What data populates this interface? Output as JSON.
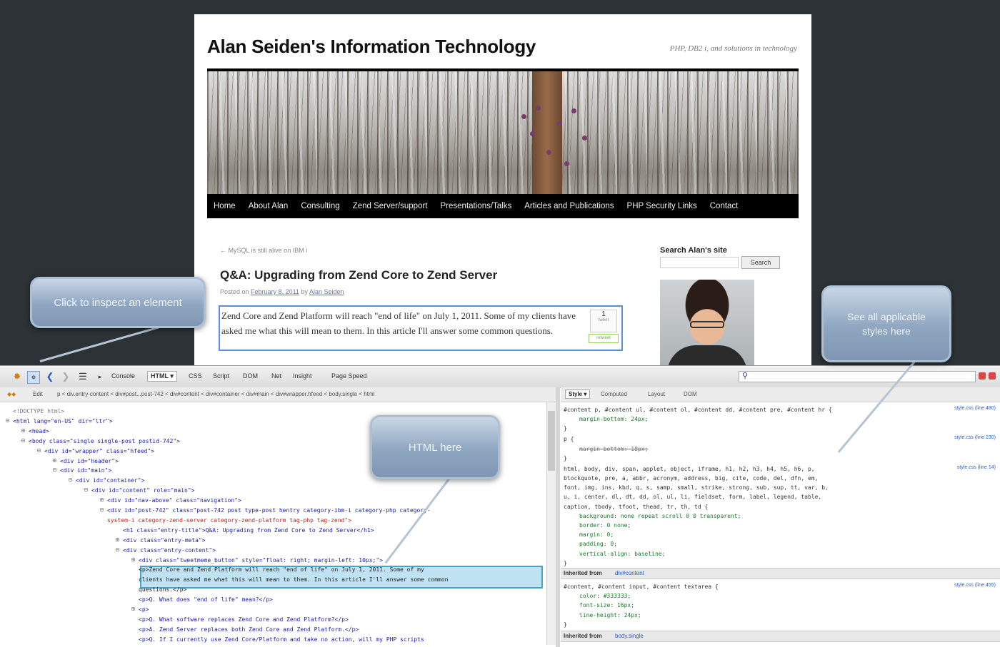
{
  "blog": {
    "title": "Alan Seiden's Information Technology",
    "description": "PHP, DB2 i, and solutions in technology",
    "nav": [
      "Home",
      "About Alan",
      "Consulting",
      "Zend Server/support",
      "Presentations/Talks",
      "Articles and Publications",
      "PHP Security Links",
      "Contact"
    ],
    "prev_link": "← MySQL is still alive on IBM i",
    "post_title": "Q&A: Upgrading from Zend Core to Zend Server",
    "meta_prefix": "Posted on",
    "meta_date": "February 8, 2011",
    "meta_by": "by",
    "meta_author": "Alan Seiden",
    "entry_text": "Zend Core and Zend Platform will reach \"end of life\" on July 1, 2011. Some of my clients have asked me what this will mean to them. In this article I'll answer some common questions.",
    "share_count": "1",
    "share_label": "tweet",
    "share_button": "retweet",
    "sidebar_search_label": "Search Alan's site",
    "sidebar_search_button": "Search"
  },
  "callouts": {
    "inspect": "Click to inspect an element",
    "html": "HTML here",
    "styles": "See all applicable styles here"
  },
  "firebug": {
    "tabs": [
      "Console",
      "HTML ▾",
      "CSS",
      "Script",
      "DOM",
      "Net",
      "Insight",
      "Page Speed"
    ],
    "active_tab": "HTML ▾",
    "edit_label": "Edit",
    "breadcrumb": "p  <  div.entry-content  <  div#post...post-742  <  div#content  <  div#container  <  div#main  <  div#wrapper.hfeed  <  body.single  <  html",
    "side_tabs": [
      "Style ▾",
      "Computed",
      "Layout",
      "DOM"
    ],
    "html_lines": [
      {
        "indent": 0,
        "text": "<!DOCTYPE html>",
        "cls": "tw"
      },
      {
        "indent": 0,
        "text": "<html lang=\"en-US\" dir=\"ltr\">",
        "cls": "tg",
        "exp": "−"
      },
      {
        "indent": 1,
        "text": "<head>",
        "cls": "tg",
        "exp": "+"
      },
      {
        "indent": 1,
        "text": "<body class=\"single single-post postid-742\">",
        "cls": "tg",
        "exp": "−"
      },
      {
        "indent": 2,
        "text": "<div id=\"wrapper\" class=\"hfeed\">",
        "cls": "tg",
        "exp": "−"
      },
      {
        "indent": 3,
        "text": "<div id=\"header\">",
        "cls": "tg",
        "exp": "+"
      },
      {
        "indent": 3,
        "text": "<div id=\"main\">",
        "cls": "tg",
        "exp": "−"
      },
      {
        "indent": 4,
        "text": "<div id=\"container\">",
        "cls": "tg",
        "exp": "−"
      },
      {
        "indent": 5,
        "text": "<div id=\"content\" role=\"main\">",
        "cls": "tg",
        "exp": "−"
      },
      {
        "indent": 6,
        "text": "<div id=\"nav-above\" class=\"navigation\">",
        "cls": "tg",
        "exp": "+"
      },
      {
        "indent": 6,
        "text": "<div id=\"post-742\" class=\"post-742 post type-post hentry category-ibm-i category-php category-",
        "cls": "tg",
        "exp": "−"
      },
      {
        "indent": 6,
        "text": "system-i category-zend-server category-zend-platform tag-php tag-zend\">",
        "cls": "st"
      },
      {
        "indent": 7,
        "text": "<h1 class=\"entry-title\">Q&A: Upgrading from Zend Core to Zend Server</h1>",
        "cls": "tg"
      },
      {
        "indent": 7,
        "text": "<div class=\"entry-meta\">",
        "cls": "tg",
        "exp": "+"
      },
      {
        "indent": 7,
        "text": "<div class=\"entry-content\">",
        "cls": "tg",
        "exp": "−"
      },
      {
        "indent": 8,
        "text": "<div class=\"tweetmeme_button\" style=\"float: right; margin-left: 10px;\">",
        "cls": "tg",
        "exp": "+"
      },
      {
        "indent": 8,
        "text": "<p>Zend Core and Zend Platform will reach \"end of life\" on July 1, 2011. Some of my",
        "cls": "tx"
      },
      {
        "indent": 8,
        "text": "clients have asked me what this will mean to them. In this article I'll answer some common",
        "cls": "tx"
      },
      {
        "indent": 8,
        "text": "questions.</p>",
        "cls": "tx"
      },
      {
        "indent": 8,
        "text": "<p>Q. What does \"end of life\" mean?</p>",
        "cls": "tg"
      },
      {
        "indent": 8,
        "text": "<p>",
        "cls": "tg",
        "exp": "+"
      },
      {
        "indent": 8,
        "text": "<p>Q. What software replaces Zend Core and Zend Platform?</p>",
        "cls": "tg"
      },
      {
        "indent": 8,
        "text": "<p>A. Zend Server replaces both Zend Core and Zend Platform.</p>",
        "cls": "tg"
      },
      {
        "indent": 8,
        "text": "<p>Q. If I currently use Zend Core/Platform and take no action, will my PHP scripts",
        "cls": "tg"
      }
    ],
    "style_rules": [
      {
        "kind": "sel",
        "text": "#content p, #content ul, #content ol, #content dd, #content pre, #content hr {",
        "src": "style.css (line 480)"
      },
      {
        "kind": "prop",
        "text": "margin-bottom: 24px;"
      },
      {
        "kind": "sel",
        "text": "}"
      },
      {
        "kind": "sel",
        "text": "p {",
        "src": "style.css (line 230)"
      },
      {
        "kind": "strike",
        "text": "margin-bottom: 18px;"
      },
      {
        "kind": "sel",
        "text": "}"
      },
      {
        "kind": "sel",
        "text": "html, body, div, span, applet, object, iframe, h1, h2, h3, h4, h5, h6, p,",
        "src": "style.css (line 14)"
      },
      {
        "kind": "sel",
        "text": "blockquote, pre, a, abbr, acronym, address, big, cite, code, del, dfn, em,"
      },
      {
        "kind": "sel",
        "text": "font, img, ins, kbd, q, s, samp, small, strike, strong, sub, sup, tt, var, b,"
      },
      {
        "kind": "sel",
        "text": "u, i, center, dl, dt, dd, ol, ul, li, fieldset, form, label, legend, table,"
      },
      {
        "kind": "sel",
        "text": "caption, tbody, tfoot, thead, tr, th, td {"
      },
      {
        "kind": "prop",
        "text": "background: none repeat scroll 0 0 transparent;"
      },
      {
        "kind": "prop",
        "text": "border: 0 none;"
      },
      {
        "kind": "prop",
        "text": "margin: 0;"
      },
      {
        "kind": "prop",
        "text": "padding: 0;"
      },
      {
        "kind": "prop",
        "text": "vertical-align: baseline;"
      },
      {
        "kind": "sel",
        "text": "}"
      }
    ],
    "inherited_1_label": "Inherited from",
    "inherited_1_sel": "div#content",
    "style_rules_2": [
      {
        "kind": "sel",
        "text": "#content, #content input, #content textarea {",
        "src": "style.css (line 455)"
      },
      {
        "kind": "prop",
        "text": "color: #333333;"
      },
      {
        "kind": "prop",
        "text": "font-size: 16px;"
      },
      {
        "kind": "prop",
        "text": "line-height: 24px;"
      },
      {
        "kind": "sel",
        "text": "}"
      }
    ],
    "inherited_2_label": "Inherited from",
    "inherited_2_sel": "body.single"
  }
}
